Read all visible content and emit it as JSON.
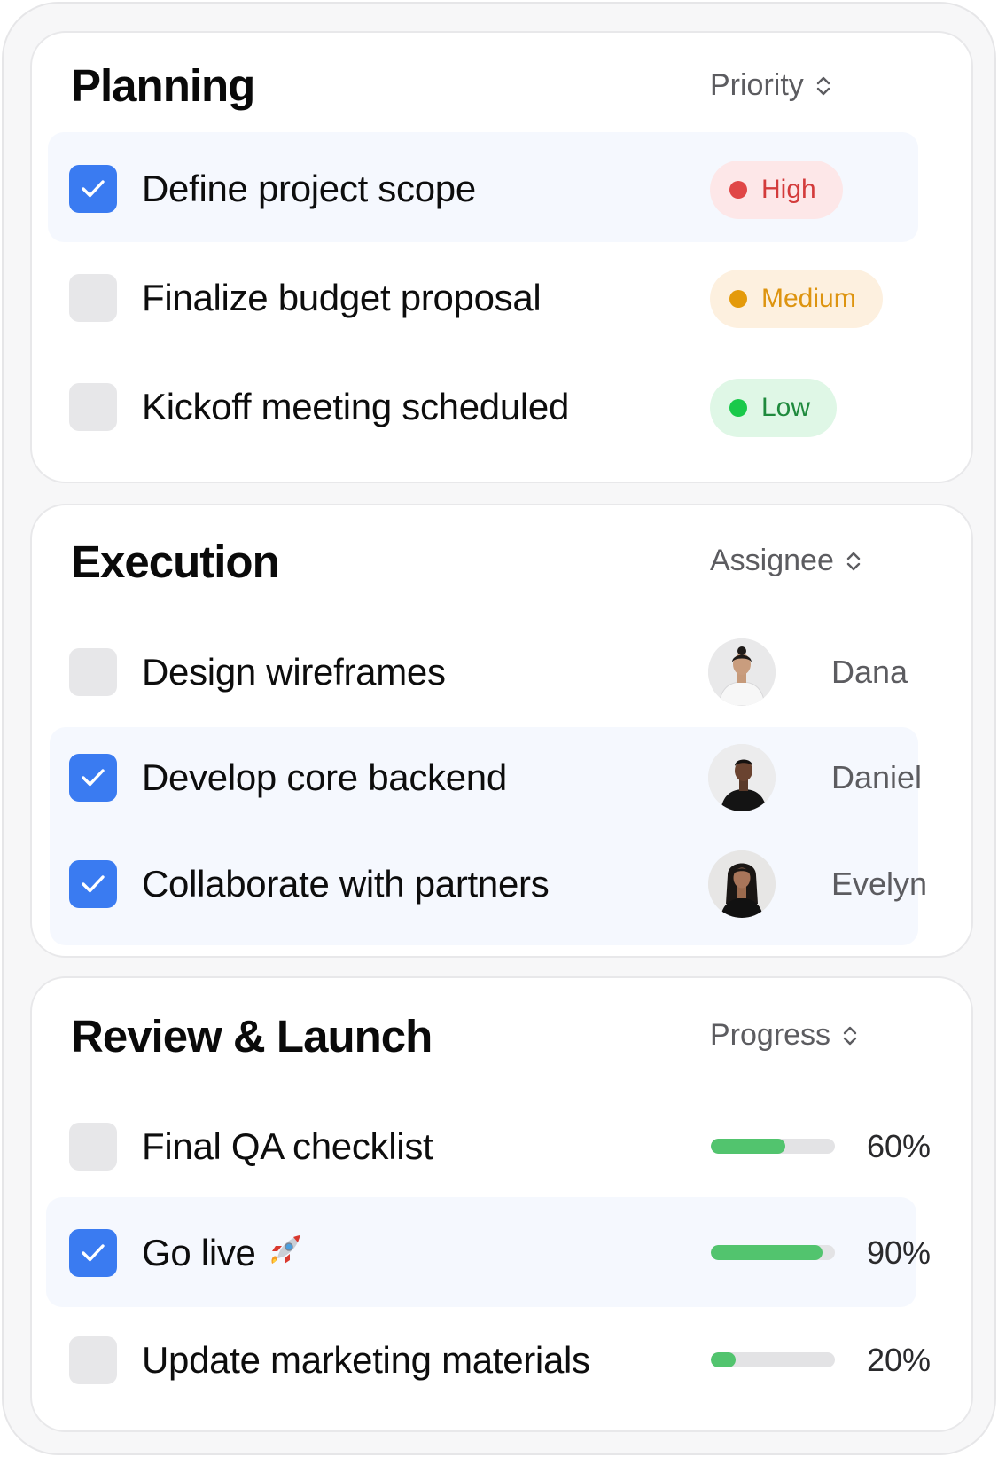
{
  "colors": {
    "accent": "#3a7bf1",
    "row_highlight": "#f5f8fe",
    "progress_fill": "#52c46e",
    "priority_high": "#e04646",
    "priority_medium": "#e49a0a",
    "priority_low": "#19c94a"
  },
  "sections": [
    {
      "title": "Planning",
      "sort_label": "Priority",
      "tasks": [
        {
          "label": "Define project scope",
          "checked": true,
          "priority": "High"
        },
        {
          "label": "Finalize budget proposal",
          "checked": false,
          "priority": "Medium"
        },
        {
          "label": "Kickoff meeting scheduled",
          "checked": false,
          "priority": "Low"
        }
      ]
    },
    {
      "title": "Execution",
      "sort_label": "Assignee",
      "tasks": [
        {
          "label": "Design wireframes",
          "checked": false,
          "assignee": "Dana"
        },
        {
          "label": "Develop core backend",
          "checked": true,
          "assignee": "Daniel"
        },
        {
          "label": "Collaborate with partners",
          "checked": true,
          "assignee": "Evelyn"
        }
      ]
    },
    {
      "title": "Review & Launch",
      "sort_label": "Progress",
      "tasks": [
        {
          "label": "Final QA checklist",
          "checked": false,
          "progress": 0.6,
          "progress_label": "60%"
        },
        {
          "label": "Go live",
          "checked": true,
          "icon": "rocket-emoji-icon",
          "progress": 0.9,
          "progress_label": "90%"
        },
        {
          "label": "Update marketing materials",
          "checked": false,
          "progress": 0.2,
          "progress_label": "20%"
        }
      ]
    }
  ]
}
